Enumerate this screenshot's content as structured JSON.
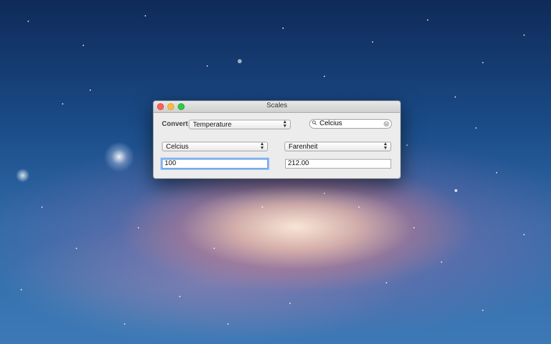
{
  "window": {
    "title": "Scales"
  },
  "convert": {
    "label": "Convert",
    "category": "Temperature"
  },
  "search": {
    "value": "Celcius"
  },
  "from": {
    "unit": "Celcius",
    "value": "100"
  },
  "to": {
    "unit": "Farenheit",
    "value": "212.00"
  }
}
